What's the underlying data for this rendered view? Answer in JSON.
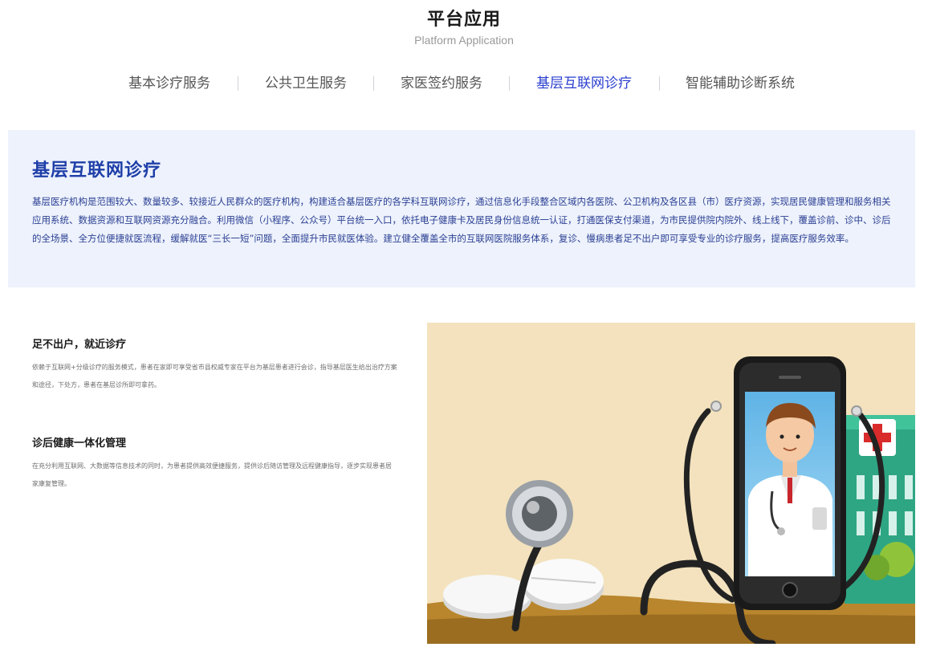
{
  "header": {
    "title": "平台应用",
    "subtitle": "Platform Application"
  },
  "tabs": [
    {
      "label": "基本诊疗服务",
      "active": false
    },
    {
      "label": "公共卫生服务",
      "active": false
    },
    {
      "label": "家医签约服务",
      "active": false
    },
    {
      "label": "基层互联网诊疗",
      "active": true
    },
    {
      "label": "智能辅助诊断系统",
      "active": false
    }
  ],
  "intro": {
    "title": "基层互联网诊疗",
    "text": "基层医疗机构是范围较大、数量较多、较接近人民群众的医疗机构，构建适合基层医疗的各学科互联网诊疗，通过信息化手段整合区域内各医院、公卫机构及各区县（市）医疗资源，实现居民健康管理和服务相关应用系统、数据资源和互联网资源充分融合。利用微信（小程序、公众号）平台统一入口，依托电子健康卡及居民身份信息统一认证，打通医保支付渠道，为市民提供院内院外、线上线下，覆盖诊前、诊中、诊后的全场景、全方位便捷就医流程，缓解就医“三长一短”问题，全面提升市民就医体验。建立健全覆盖全市的互联网医院服务体系，复诊、慢病患者足不出户即可享受专业的诊疗服务，提高医疗服务效率。"
  },
  "features": [
    {
      "title": "足不出户，就近诊疗",
      "desc": "依赖于互联网+分级诊疗的服务模式，患者在家即可享受省市县权威专家在平台为基层患者进行会诊，指导基层医生给出治疗方案和途径，下处方，患者在基层诊所即可拿药。"
    },
    {
      "title": "诊后健康一体化管理",
      "desc": "在充分利用互联网、大数据等信息技术的同时，为患者提供高效便捷服务，提供诊后随访管理及远程健康指导，逐步实现患者居家康复管理。"
    }
  ],
  "colors": {
    "accent": "#2b3fcf",
    "intro_bg": "#edf2fc",
    "intro_text": "#2b3f93"
  },
  "illustration": {
    "icons": [
      "smartphone-icon",
      "doctor-icon",
      "stethoscope-icon",
      "pills-icon",
      "hospital-icon"
    ]
  }
}
